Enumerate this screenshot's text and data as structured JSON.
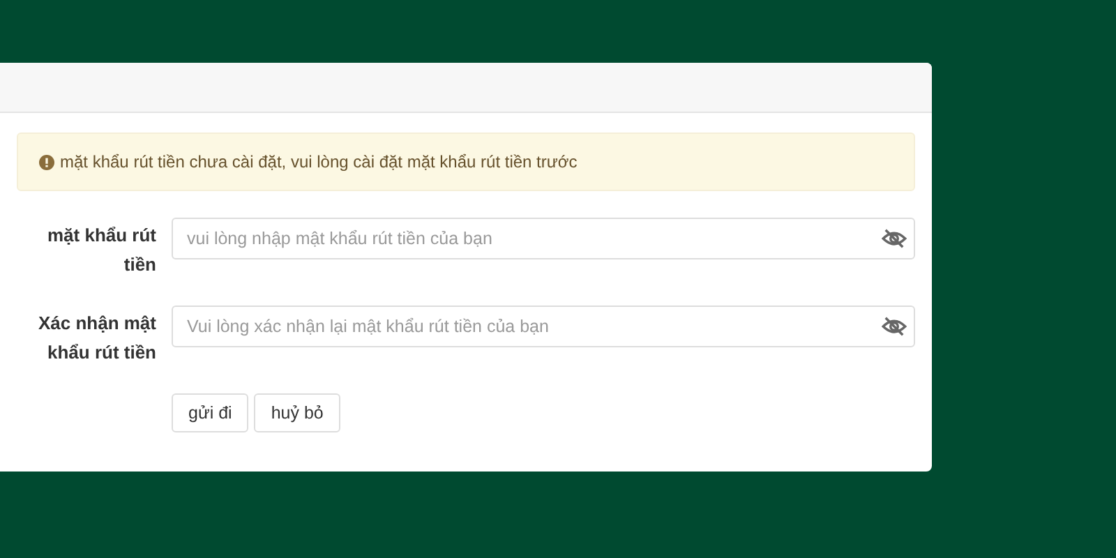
{
  "alert": {
    "text": "mặt khẩu rút tiền chưa cài đặt, vui lòng cài đặt mặt khẩu rút tiền trước"
  },
  "fields": [
    {
      "label": "mặt khẩu rút tiền",
      "placeholder": "vui lòng nhập mật khẩu rút tiền của bạn"
    },
    {
      "label": "Xác nhận mật khẩu rút tiền",
      "placeholder": "Vui lòng xác nhận lại mật khẩu rút tiền của bạn"
    }
  ],
  "buttons": [
    "gửi đi",
    "huỷ bỏ"
  ]
}
